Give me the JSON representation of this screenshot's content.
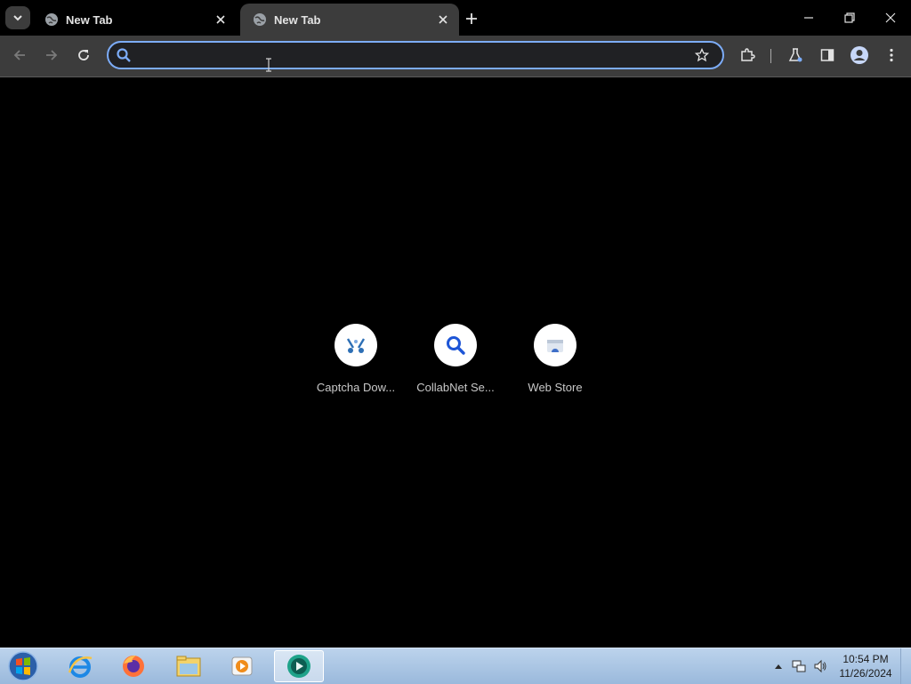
{
  "tabs": [
    {
      "title": "New Tab",
      "active": false
    },
    {
      "title": "New Tab",
      "active": true
    }
  ],
  "omnibox": {
    "value": "",
    "placeholder": ""
  },
  "shortcuts": [
    {
      "label": "Captcha Dow...",
      "icon": "captcha-icon"
    },
    {
      "label": "CollabNet Se...",
      "icon": "magnifier-icon"
    },
    {
      "label": "Web Store",
      "icon": "web-store-icon"
    }
  ],
  "taskbar": {
    "apps": [
      "start-orb",
      "internet-explorer-icon",
      "firefox-icon",
      "file-explorer-icon",
      "media-player-icon",
      "chrome-app-icon"
    ],
    "time": "10:54 PM",
    "date": "11/26/2024"
  },
  "colors": {
    "accent": "#7cacf8",
    "toolbar": "#3c3c3c",
    "page_background": "#000000"
  }
}
